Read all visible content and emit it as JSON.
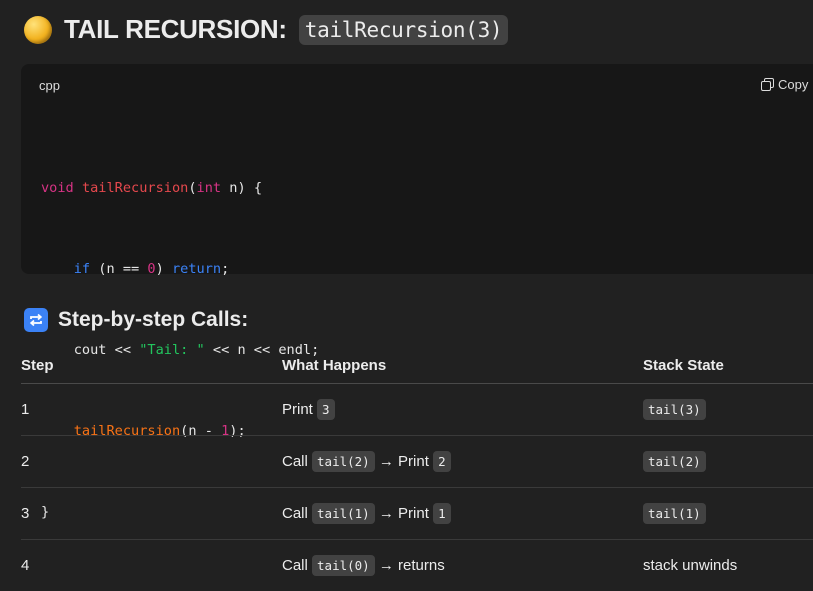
{
  "title": {
    "text": "TAIL RECURSION:",
    "code": "tailRecursion(3)"
  },
  "code_block": {
    "language": "cpp",
    "copy_label": "Copy",
    "lines": [
      "void tailRecursion(int n) {",
      "    if (n == 0) return;",
      "    cout << \"Tail: \" << n << endl;",
      "    tailRecursion(n - 1);",
      "}"
    ]
  },
  "section": {
    "title": "Step-by-step Calls:"
  },
  "table": {
    "headers": [
      "Step",
      "What Happens",
      "Stack State"
    ],
    "rows": [
      {
        "step": "1",
        "what": [
          "Print ",
          "3"
        ],
        "stack": "tail(3)",
        "stack_is_code": true
      },
      {
        "step": "2",
        "what": [
          "Call ",
          "tail(2)",
          " → Print ",
          "2"
        ],
        "stack": "tail(2)",
        "stack_is_code": true
      },
      {
        "step": "3",
        "what": [
          "Call ",
          "tail(1)",
          " → Print ",
          "1"
        ],
        "stack": "tail(1)",
        "stack_is_code": true
      },
      {
        "step": "4",
        "what": [
          "Call ",
          "tail(0)",
          " → returns"
        ],
        "stack": "stack unwinds",
        "stack_is_code": false
      }
    ]
  }
}
